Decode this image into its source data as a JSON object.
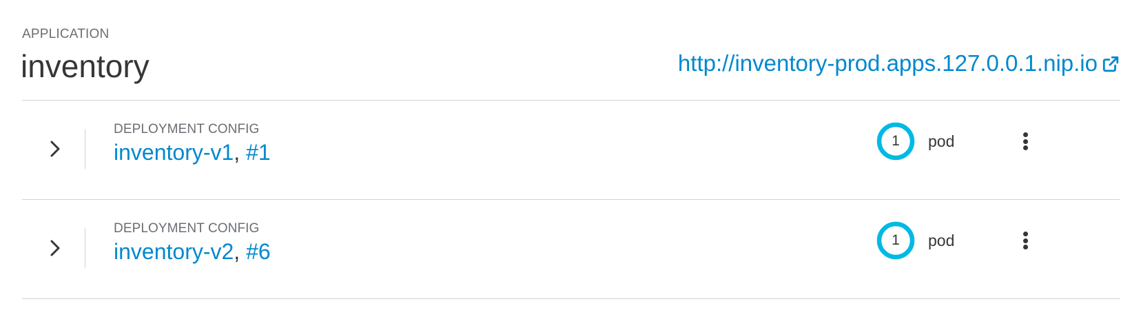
{
  "application": {
    "kicker": "APPLICATION",
    "name": "inventory",
    "route_url": "http://inventory-prod.apps.127.0.0.1.nip.io",
    "route_icon": "external-link-icon"
  },
  "deployments": [
    {
      "kind": "DEPLOYMENT CONFIG",
      "name": "inventory-v1",
      "separator": ", ",
      "revision": "#1",
      "pod_count": "1",
      "pod_label": "pod",
      "expand_icon": "chevron-right-icon",
      "menu_icon": "kebab-menu-icon"
    },
    {
      "kind": "DEPLOYMENT CONFIG",
      "name": "inventory-v2",
      "separator": ", ",
      "revision": "#6",
      "pod_count": "1",
      "pod_label": "pod",
      "expand_icon": "chevron-right-icon",
      "menu_icon": "kebab-menu-icon"
    }
  ],
  "colors": {
    "link": "#0088ce",
    "donut_ring": "#00b9e4",
    "text": "#363636",
    "muted": "#6a6e73",
    "border": "#d1d1d1"
  }
}
